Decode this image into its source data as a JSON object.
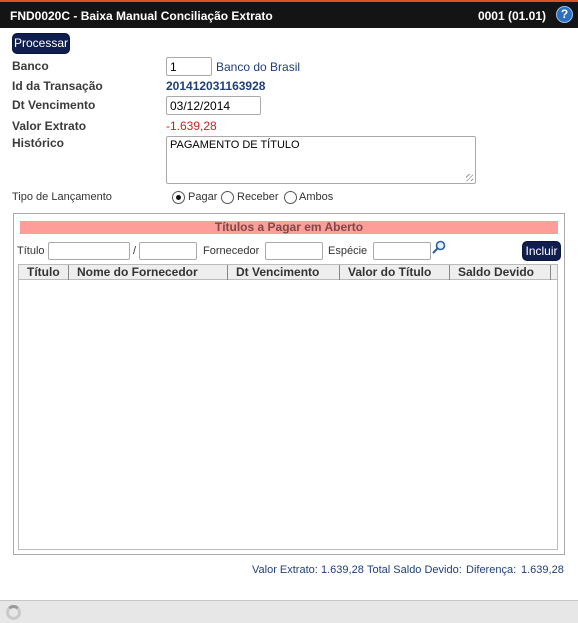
{
  "window": {
    "title": "FND0020C - Baixa Manual Conciliação Extrato",
    "version": "0001 (01.01)",
    "help_glyph": "?"
  },
  "toolbar": {
    "process_label": "Processar"
  },
  "form": {
    "banco": {
      "label": "Banco",
      "value": "1",
      "name": "Banco do Brasil"
    },
    "id_transacao": {
      "label": "Id da Transação",
      "value": "201412031163928"
    },
    "dt_vencimento": {
      "label": "Dt Vencimento",
      "value": "03/12/2014"
    },
    "valor_extrato": {
      "label": "Valor Extrato",
      "value": "-1.639,28"
    },
    "historico": {
      "label": "Histórico",
      "value": "PAGAMENTO DE TÍTULO"
    },
    "tipo_lancamento": {
      "label": "Tipo de Lançamento",
      "options": [
        "Pagar",
        "Receber",
        "Ambos"
      ],
      "selected": "Pagar"
    }
  },
  "panel": {
    "title": "Títulos a Pagar em Aberto",
    "filters": {
      "titulo_label": "Título",
      "separator": "/",
      "fornecedor_label": "Fornecedor",
      "especie_label": "Espécie",
      "titulo_value": "",
      "titulo_sub_value": "",
      "fornecedor_value": "",
      "especie_value": ""
    },
    "add_label": "Incluir",
    "columns": [
      "Título",
      "Nome do Fornecedor",
      "Dt Vencimento",
      "Valor do Título",
      "Saldo Devido"
    ],
    "rows": []
  },
  "summary": {
    "valor_extrato_label": "Valor Extrato:",
    "valor_extrato": "1.639,28",
    "saldo_label": "Total Saldo Devido:",
    "saldo": "",
    "diferenca_label": "Diferença:",
    "diferenca": "1.639,28"
  },
  "colors": {
    "titlebar": "#141414",
    "accent": "#d9531e",
    "button": "#0f1e4f",
    "panel_header": "#ff9e99",
    "value_red": "#cc2222",
    "value_blue": "#1f3f7a"
  },
  "icons": {
    "help": "help-icon",
    "search": "search-icon",
    "loading": "spinner-icon"
  }
}
